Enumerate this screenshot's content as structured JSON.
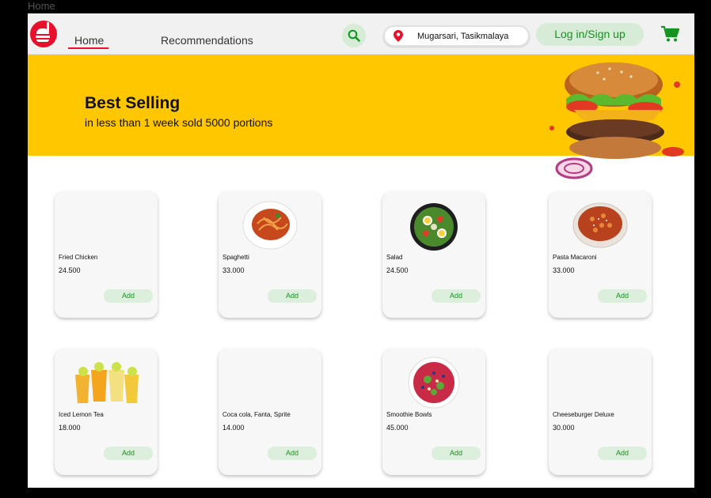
{
  "frame_label": "Home",
  "brand": {
    "accent": "#e8102a",
    "green": "#15941f",
    "banner_bg": "#ffc700"
  },
  "nav": {
    "home_label": "Home",
    "recommendations_label": "Recommendations",
    "location": "Mugarsari, Tasikmalaya",
    "login_label": "Log in/Sign up",
    "icons": [
      "logo-burger-icon",
      "search-icon",
      "location-pin-icon",
      "cart-icon"
    ]
  },
  "banner": {
    "title": "Best Selling",
    "subtitle": "in less than 1 week sold 5000 portions"
  },
  "products": [
    {
      "name": "Fried Chicken",
      "price": "24.500",
      "add_label": "Add"
    },
    {
      "name": "Spaghetti",
      "price": "33.000",
      "add_label": "Add"
    },
    {
      "name": "Salad",
      "price": "24.500",
      "add_label": "Add"
    },
    {
      "name": "Pasta Macaroni",
      "price": "33.000",
      "add_label": "Add"
    },
    {
      "name": "Iced Lemon Tea",
      "price": "18.000",
      "add_label": "Add"
    },
    {
      "name": "Coca cola, Fanta, Sprite",
      "price": "14.000",
      "add_label": "Add"
    },
    {
      "name": "Smoothie Bowls",
      "price": "45.000",
      "add_label": "Add"
    },
    {
      "name": "Cheeseburger Deluxe",
      "price": "30.000",
      "add_label": "Add"
    }
  ]
}
